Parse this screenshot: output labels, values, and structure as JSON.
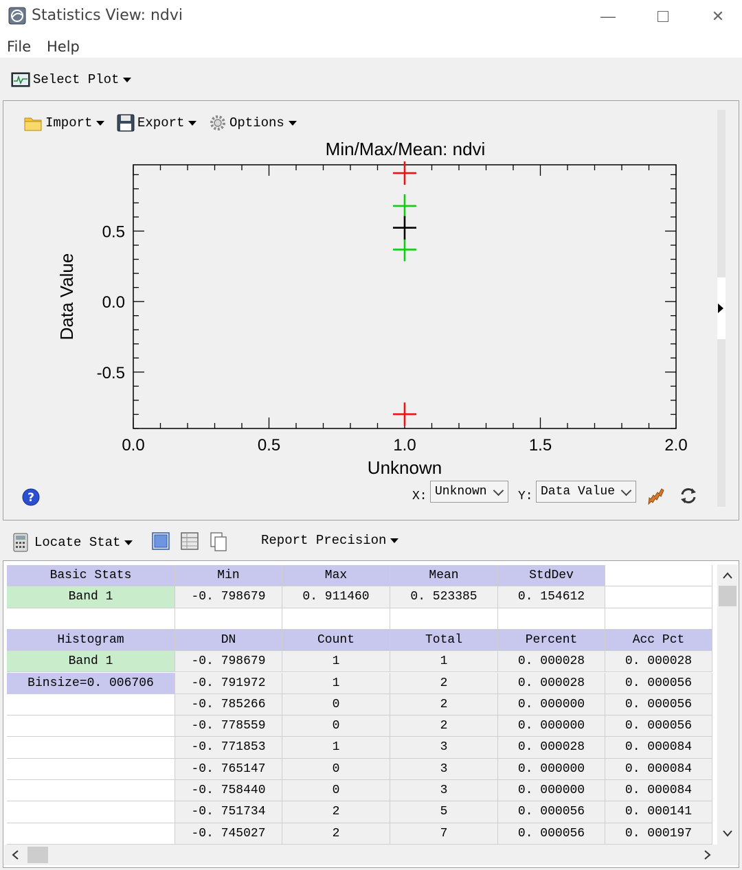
{
  "window": {
    "title": "Statistics View: ndvi"
  },
  "menu": [
    "File",
    "Help"
  ],
  "toolbar": {
    "select_plot": "Select Plot"
  },
  "plot_toolbar": {
    "import": "Import",
    "export": "Export",
    "options": "Options"
  },
  "chart_data": {
    "type": "scatter",
    "title": "Min/Max/Mean: ndvi",
    "xlabel": "Unknown",
    "ylabel": "Data Value",
    "xlim": [
      0.0,
      2.0
    ],
    "ylim": [
      -0.9,
      0.97
    ],
    "x_ticks": [
      "0.0",
      "0.5",
      "1.0",
      "1.5",
      "2.0"
    ],
    "y_ticks": [
      "0.5",
      "0.0",
      "-0.5"
    ],
    "y_tick_values": [
      0.5,
      0.0,
      -0.5
    ],
    "points": [
      {
        "x": 1.0,
        "y": 0.91146,
        "color": "#ee1111"
      },
      {
        "x": 1.0,
        "y": -0.798679,
        "color": "#ee1111"
      },
      {
        "x": 1.0,
        "y": 0.677997,
        "color": "#11cc11"
      },
      {
        "x": 1.0,
        "y": 0.368773,
        "color": "#11cc11"
      },
      {
        "x": 1.0,
        "y": 0.523385,
        "color": "#000000"
      }
    ]
  },
  "axis_select": {
    "x_label": "X:",
    "x_value": "Unknown",
    "y_label": "Y:",
    "y_value": "Data Value"
  },
  "stats_toolbar": {
    "locate_stat": "Locate Stat",
    "report_precision": "Report Precision"
  },
  "basic_stats": {
    "headers": [
      "Basic Stats",
      "Min",
      "Max",
      "Mean",
      "StdDev",
      ""
    ],
    "row": [
      "Band 1",
      "-0. 798679",
      "0. 911460",
      "0. 523385",
      "0. 154612",
      ""
    ]
  },
  "histogram": {
    "headers": [
      "Histogram",
      "DN",
      "Count",
      "Total",
      "Percent",
      "Acc Pct"
    ],
    "rows": [
      [
        "Band 1",
        "-0. 798679",
        "1",
        "1",
        "0. 000028",
        "0. 000028"
      ],
      [
        "Binsize=0. 006706",
        "-0. 791972",
        "1",
        "2",
        "0. 000028",
        "0. 000056"
      ],
      [
        "",
        "-0. 785266",
        "0",
        "2",
        "0. 000000",
        "0. 000056"
      ],
      [
        "",
        "-0. 778559",
        "0",
        "2",
        "0. 000000",
        "0. 000056"
      ],
      [
        "",
        "-0. 771853",
        "1",
        "3",
        "0. 000028",
        "0. 000084"
      ],
      [
        "",
        "-0. 765147",
        "0",
        "3",
        "0. 000000",
        "0. 000084"
      ],
      [
        "",
        "-0. 758440",
        "0",
        "3",
        "0. 000000",
        "0. 000084"
      ],
      [
        "",
        "-0. 751734",
        "2",
        "5",
        "0. 000056",
        "0. 000141"
      ],
      [
        "",
        "-0. 745027",
        "2",
        "7",
        "0. 000056",
        "0. 000197"
      ]
    ]
  }
}
